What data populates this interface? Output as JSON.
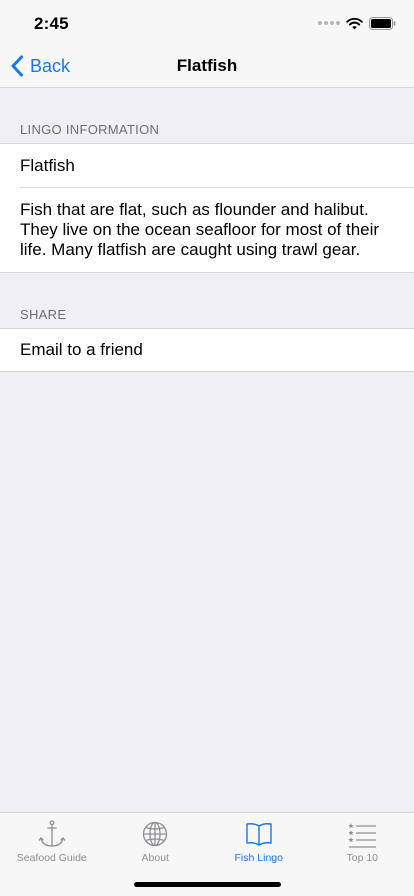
{
  "status_bar": {
    "time": "2:45"
  },
  "nav": {
    "back_label": "Back",
    "title": "Flatfish"
  },
  "lingo_section": {
    "header": "LINGO INFORMATION",
    "term": "Flatfish",
    "description": "Fish that are flat, such as flounder and halibut. They live on the ocean seafloor for most of their life. Many flatfish are caught using trawl gear."
  },
  "share_section": {
    "header": "SHARE",
    "email_label": "Email to a friend"
  },
  "tab_bar": {
    "active_tab": "Fish Lingo",
    "items": [
      {
        "label": "Seafood Guide",
        "icon": "anchor-icon"
      },
      {
        "label": "About",
        "icon": "globe-icon"
      },
      {
        "label": "Fish Lingo",
        "icon": "book-icon"
      },
      {
        "label": "Top 10",
        "icon": "star-list-icon"
      }
    ]
  },
  "colors": {
    "accent": "#1478f6",
    "inactive": "#8e8e93",
    "background": "#efeff4",
    "bar_background": "#f7f7f7"
  }
}
